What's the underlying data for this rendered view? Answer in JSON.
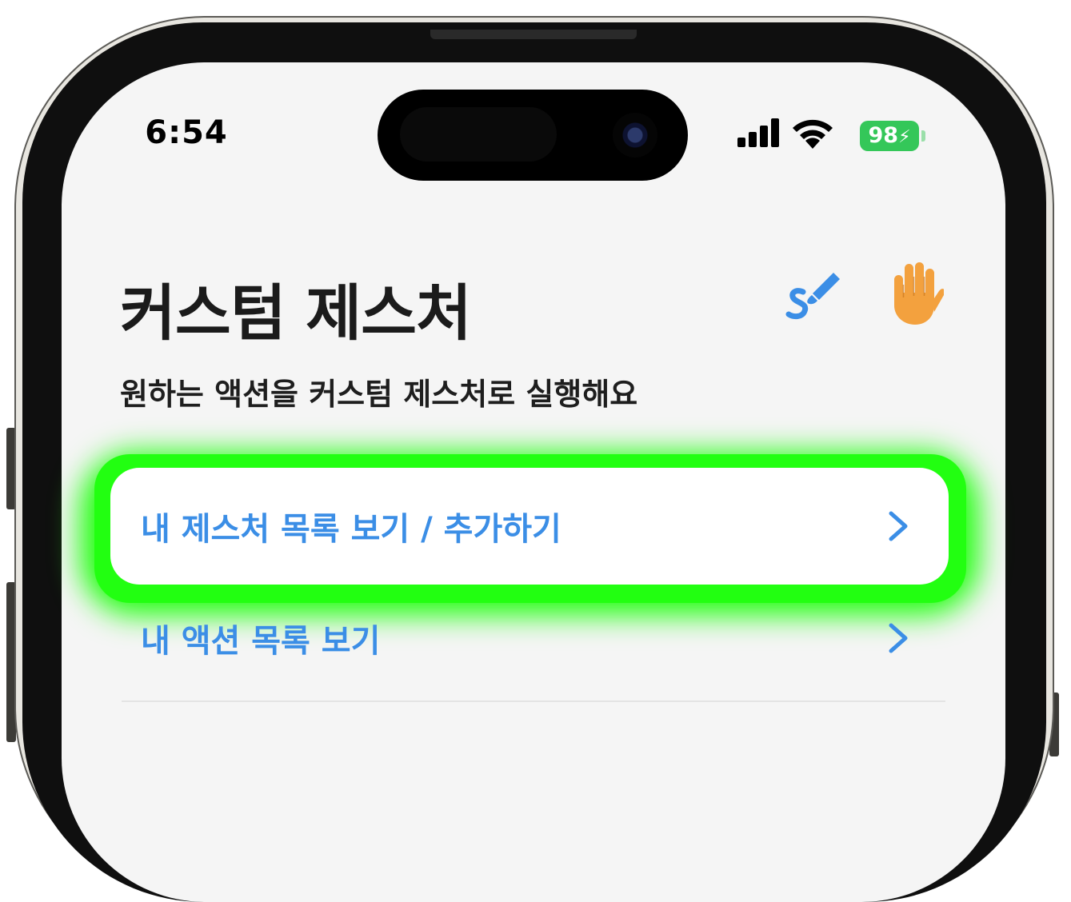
{
  "status_bar": {
    "time": "6:54",
    "battery_level": "98",
    "battery_color": "#34c759",
    "icons": [
      "signal-icon",
      "wifi-icon",
      "battery-charging-icon"
    ]
  },
  "header": {
    "title": "커스텀 제스처",
    "subtitle": "원하는 액션을 커스텀 제스처로 실행해요",
    "icons": [
      "brush-icon",
      "raised-hand-icon"
    ]
  },
  "menu": {
    "items": [
      {
        "label": "내 제스처 목록 보기 / 추가하기",
        "icon": "chevron-right-icon",
        "highlighted": true
      },
      {
        "label": "내 액션 목록 보기",
        "icon": "chevron-right-icon",
        "highlighted": false
      }
    ]
  },
  "colors": {
    "accent": "#3b8ee6",
    "highlight_glow": "#22ff11",
    "hand": "#f3a13e"
  }
}
